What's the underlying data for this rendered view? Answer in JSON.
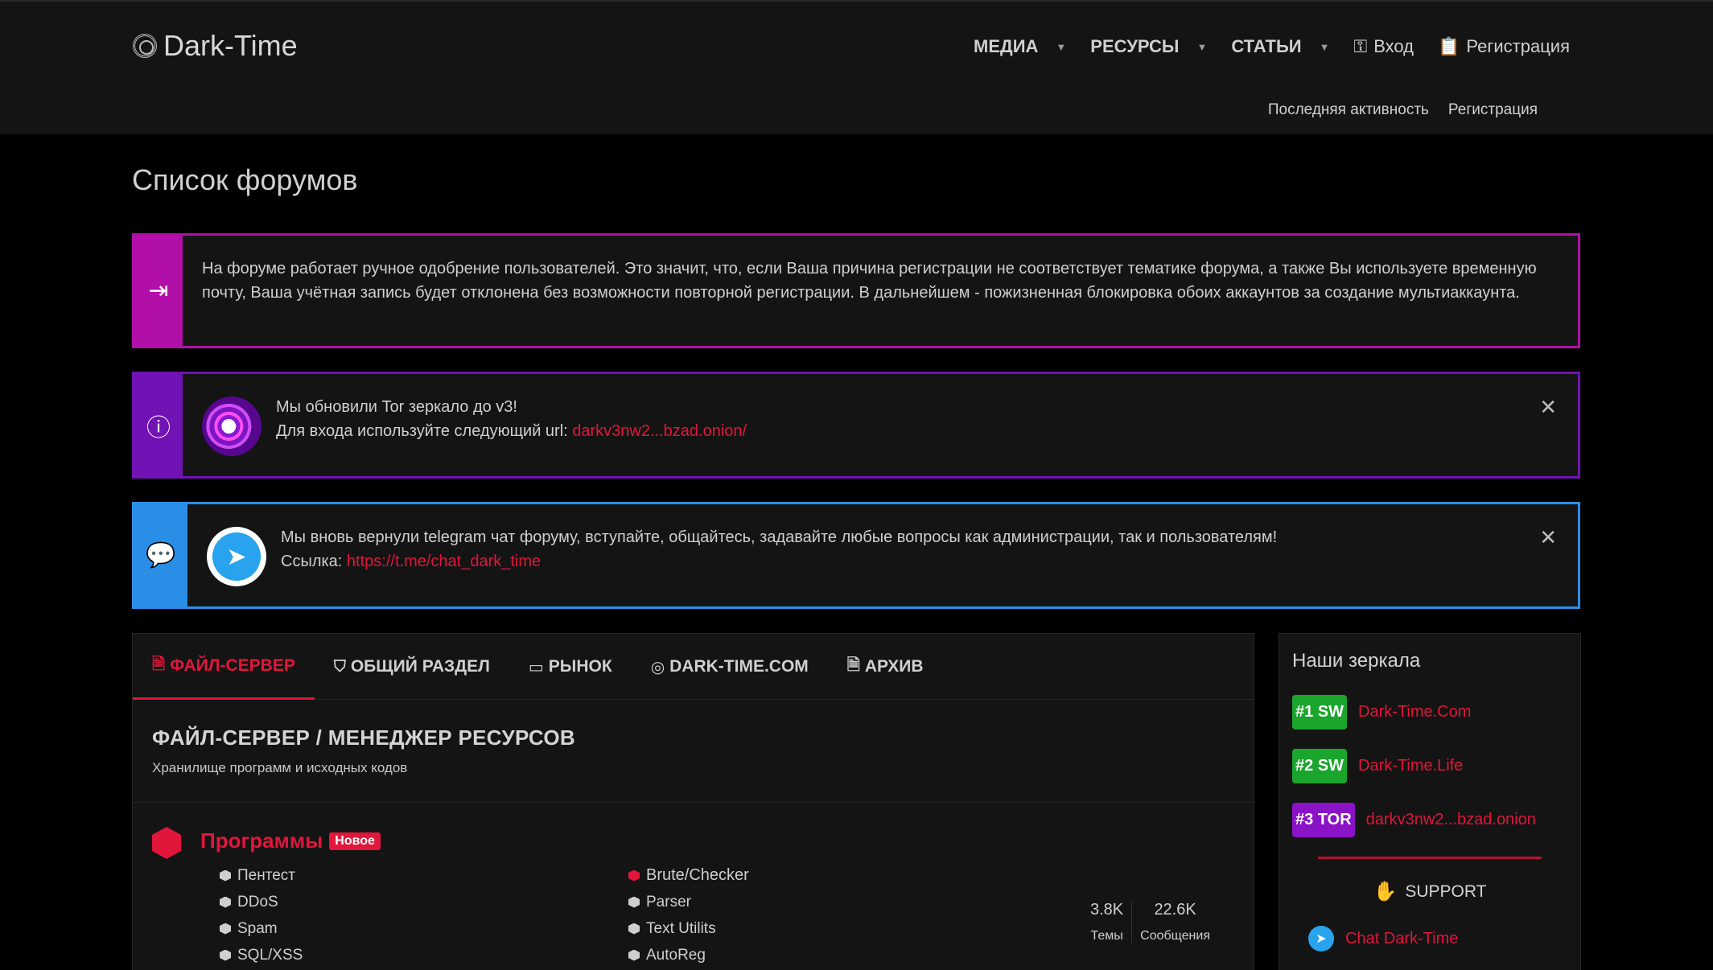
{
  "header": {
    "logo_text": "Dark-Time",
    "nav": [
      {
        "label": "МЕДИА"
      },
      {
        "label": "РЕСУРСЫ"
      },
      {
        "label": "СТАТЬИ"
      }
    ],
    "login_label": "Вход",
    "register_label": "Регистрация",
    "subnav": [
      "Последняя активность",
      "Регистрация"
    ]
  },
  "page_title": "Список форумов",
  "notices": {
    "manual_approval": "На форуме работает ручное одобрение пользователей. Это значит, что, если Ваша причина регистрации не соответствует тематике форума, а также Вы используете временную почту, Ваша учётная запись будет отклонена без возможности повторной регистрации. В дальнейшем - пожизненная блокировка обоих аккаунтов за создание мультиаккаунта.",
    "tor_line1": "Мы обновили Tor зеркало до v3!",
    "tor_line2_prefix": "Для входа используйте следующий url: ",
    "tor_url": "darkv3nw2...bzad.onion/",
    "tg_line1": "Мы вновь вернули telegram чат форуму, вступайте, общайтесь, задавайте любые вопросы как администрации, так и пользователям!",
    "tg_line2_prefix": "Ссылка: ",
    "tg_url": "https://t.me/chat_dark_time",
    "close": "✕"
  },
  "tabs": [
    {
      "label": "ФАЙЛ-СЕРВЕР",
      "icon": "file-icon",
      "glyph": "🗎"
    },
    {
      "label": "ОБЩИЙ РАЗДЕЛ",
      "icon": "shield-icon",
      "glyph": "⛉"
    },
    {
      "label": "РЫНОК",
      "icon": "card-icon",
      "glyph": "▭"
    },
    {
      "label": "DARK-TIME.COM",
      "icon": "fingerprint-icon",
      "glyph": "◎"
    },
    {
      "label": "АРХИВ",
      "icon": "archive-icon",
      "glyph": "🗎"
    }
  ],
  "section": {
    "title": "ФАЙЛ-СЕРВЕР / МЕНЕДЖЕР РЕСУРСОВ",
    "description": "Хранилище программ и исходных кодов"
  },
  "forum": {
    "name": "Программы",
    "new_badge": "Новое",
    "subforums_col1": [
      "Пентест",
      "DDoS",
      "Spam",
      "SQL/XSS"
    ],
    "subforums_col2": [
      "Brute/Checker",
      "Parser",
      "Text Utilits",
      "AutoReg"
    ],
    "threads_value": "3.8K",
    "threads_label": "Темы",
    "posts_value": "22.6K",
    "posts_label": "Сообщения"
  },
  "sidebar": {
    "title": "Наши зеркала",
    "mirrors": [
      {
        "tag": "#1 SW",
        "url": "Dark-Time.Com",
        "color": "#1aa52c"
      },
      {
        "tag": "#2 SW",
        "url": "Dark-Time.Life",
        "color": "#1aa52c"
      },
      {
        "tag": "#3 TOR",
        "url": "darkv3nw2...bzad.onion",
        "color": "#8a12c7"
      }
    ],
    "support_label": "SUPPORT",
    "chat_label": "Chat Dark-Time"
  },
  "colors": {
    "accent": "#e0163a",
    "notice_magenta": "#b10fa8",
    "notice_purple": "#7112b5",
    "notice_blue": "#2a8ee6"
  }
}
